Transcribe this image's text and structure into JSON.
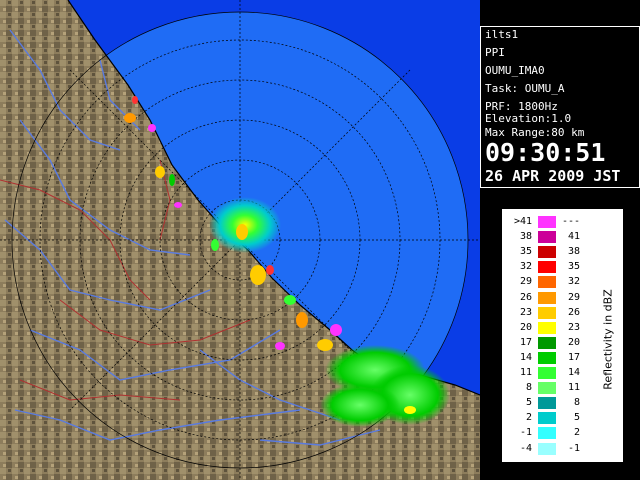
{
  "info": {
    "site": "ilts1",
    "mode": "PPI",
    "product": "OUMU_IMA0",
    "task": "Task: OUMU_A",
    "prf": "PRF: 1800Hz",
    "elevation": "Elevation:1.0",
    "range": "Max Range:80 km",
    "time": "09:30:51",
    "date": "26 APR 2009 JST"
  },
  "legend": {
    "title": "Reflectivity in dBZ",
    "levels": [
      {
        "lo": ">41",
        "hi": "---",
        "color": "#ff33ff"
      },
      {
        "lo": "38",
        "hi": "41",
        "color": "#cc0099"
      },
      {
        "lo": "35",
        "hi": "38",
        "color": "#cc0000"
      },
      {
        "lo": "32",
        "hi": "35",
        "color": "#ff0000"
      },
      {
        "lo": "29",
        "hi": "32",
        "color": "#ff6600"
      },
      {
        "lo": "26",
        "hi": "29",
        "color": "#ff9900"
      },
      {
        "lo": "23",
        "hi": "26",
        "color": "#ffcc00"
      },
      {
        "lo": "20",
        "hi": "23",
        "color": "#ffff00"
      },
      {
        "lo": "17",
        "hi": "20",
        "color": "#009900"
      },
      {
        "lo": "14",
        "hi": "17",
        "color": "#00cc00"
      },
      {
        "lo": "11",
        "hi": "14",
        "color": "#33ff33"
      },
      {
        "lo": "8",
        "hi": "11",
        "color": "#66ff66"
      },
      {
        "lo": "5",
        "hi": "8",
        "color": "#009999"
      },
      {
        "lo": "2",
        "hi": "5",
        "color": "#00cccc"
      },
      {
        "lo": "-1",
        "hi": "2",
        "color": "#33ffff"
      },
      {
        "lo": "-4",
        "hi": "-1",
        "color": "#99ffff"
      }
    ]
  },
  "colors": {
    "sea": "#0a3de6",
    "radar_disc": "#1f6cf5",
    "land": "#8a7a5a",
    "rivers": "#5a7be0",
    "borders": "#b03030"
  }
}
